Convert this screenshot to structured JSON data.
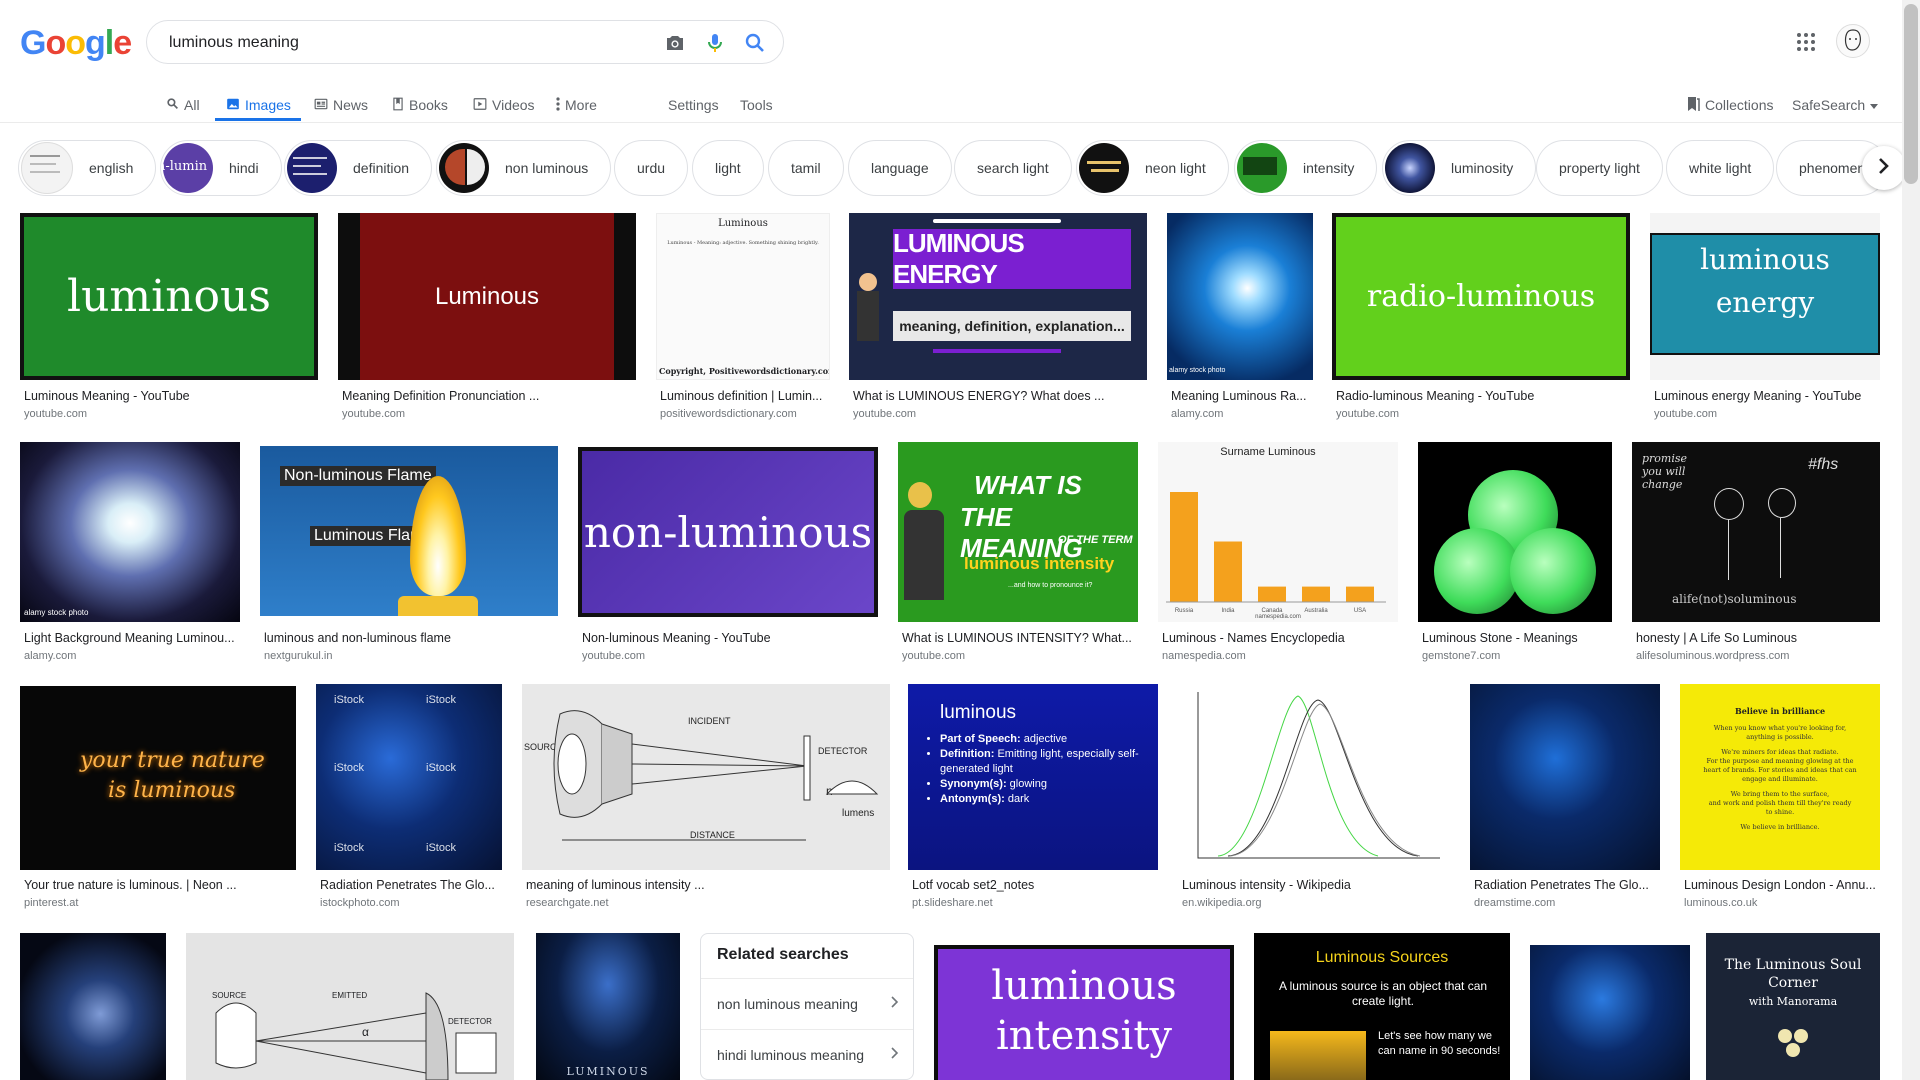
{
  "logo": {
    "letters": [
      "G",
      "o",
      "o",
      "g",
      "l",
      "e"
    ],
    "colors": [
      "#4285f4",
      "#ea4335",
      "#fbbc05",
      "#4285f4",
      "#34a853",
      "#ea4335"
    ]
  },
  "search": {
    "query": "luminous meaning"
  },
  "tabs": [
    {
      "label": "All",
      "icon": "search-icon"
    },
    {
      "label": "Images",
      "icon": "image-icon"
    },
    {
      "label": "News",
      "icon": "news-icon"
    },
    {
      "label": "Books",
      "icon": "book-icon"
    },
    {
      "label": "Videos",
      "icon": "video-icon"
    },
    {
      "label": "More",
      "icon": "more-vert-icon"
    }
  ],
  "settings_label": "Settings",
  "tools_label": "Tools",
  "collections_label": "Collections",
  "safesearch_label": "SafeSearch",
  "chips": [
    {
      "label": "english"
    },
    {
      "label": "hindi"
    },
    {
      "label": "definition"
    },
    {
      "label": "non luminous"
    },
    {
      "label": "urdu"
    },
    {
      "label": "light"
    },
    {
      "label": "tamil"
    },
    {
      "label": "language"
    },
    {
      "label": "search light"
    },
    {
      "label": "neon light"
    },
    {
      "label": "intensity"
    },
    {
      "label": "luminosity"
    },
    {
      "label": "property light"
    },
    {
      "label": "white light"
    },
    {
      "label": "phenomen"
    }
  ],
  "chip_thumb_text": {
    "hindi": "n-lumin"
  },
  "results": [
    {
      "title": "Luminous Meaning - YouTube",
      "source": "youtube.com",
      "img_text": "luminous"
    },
    {
      "title": "Meaning Definition Pronunciation ...",
      "source": "youtube.com",
      "img_text": "Luminous"
    },
    {
      "title": "Luminous definition | Lumin...",
      "source": "positivewordsdictionary.com",
      "img_text": "Luminous",
      "img_subtext": "Luminous - Meaning: adjective. Something shining brightly.",
      "img_footer": "Copyright, Positivewordsdictionary.com"
    },
    {
      "title": "What is LUMINOUS ENERGY? What does ...",
      "source": "youtube.com",
      "img_text": "LUMINOUS ENERGY",
      "img_subtext": "meaning, definition, explanation..."
    },
    {
      "title": "Meaning Luminous Ra...",
      "source": "alamy.com",
      "img_footer": "alamy stock photo"
    },
    {
      "title": "Radio-luminous Meaning - YouTube",
      "source": "youtube.com",
      "img_text": "radio-luminous"
    },
    {
      "title": "Luminous energy Meaning - YouTube",
      "source": "youtube.com",
      "img_text": "luminous",
      "img_subtext": "energy"
    },
    {
      "title": "Light Background Meaning Luminou...",
      "source": "alamy.com",
      "img_footer": "alamy stock photo"
    },
    {
      "title": "luminous and non-luminous flame",
      "source": "nextgurukul.in",
      "img_text": "Non-luminous Flame",
      "img_subtext": "Luminous Flame"
    },
    {
      "title": "Non-luminous Meaning - YouTube",
      "source": "youtube.com",
      "img_text": "non-luminous"
    },
    {
      "title": "What is LUMINOUS INTENSITY? What...",
      "source": "youtube.com",
      "img_text": "WHAT IS",
      "img_subtext": "THE MEANING",
      "img_line3": "OF THE TERM",
      "img_line4": "luminous intensity",
      "img_footer": "...and how to pronounce it?"
    },
    {
      "title": "Luminous - Names Encyclopedia",
      "source": "namespedia.com",
      "img_text": "Surname Luminous",
      "img_footer": "namespedia.com"
    },
    {
      "title": "Luminous Stone - Meanings",
      "source": "gemstone7.com"
    },
    {
      "title": "honesty | A Life So Luminous",
      "source": "alifesoluminous.wordpress.com",
      "img_text": "promise you will change",
      "img_subtext": "#fhs",
      "img_footer": "alife(not)soluminous"
    },
    {
      "title": "Your true nature is luminous. | Neon ...",
      "source": "pinterest.at",
      "img_text": "your true nature",
      "img_subtext": "is luminous"
    },
    {
      "title": "Radiation Penetrates The Glo...",
      "source": "istockphoto.com",
      "img_text": "iStock"
    },
    {
      "title": "meaning of luminous intensity ...",
      "source": "researchgate.net",
      "img_text": "INCIDENT",
      "img_subtext": "SOURCE",
      "img_line3": "DETECTOR",
      "img_line4": "lumens",
      "img_footer": "DISTANCE",
      "img_extra": "n"
    },
    {
      "title": "Lotf vocab set2_notes",
      "source": "pt.slideshare.net",
      "img_text": "luminous",
      "slide_lines": [
        {
          "k": "Part of Speech:",
          "v": " adjective"
        },
        {
          "k": "Definition:",
          "v": " Emitting light, especially self-generated light"
        },
        {
          "k": "Synonym(s):",
          "v": " glowing"
        },
        {
          "k": "Antonym(s):",
          "v": " dark"
        }
      ]
    },
    {
      "title": "Luminous intensity - Wikipedia",
      "source": "en.wikipedia.org"
    },
    {
      "title": "Radiation Penetrates The Glo...",
      "source": "dreamstime.com"
    },
    {
      "title": "Luminous Design London - Annu...",
      "source": "luminous.co.uk",
      "img_text": "Believe in brilliance",
      "img_lines": [
        "When you know what you're looking for,",
        "anything is possible.",
        "We're miners for ideas that radiate.",
        "For the purpose and meaning glowing at the",
        "heart of brands. For stories and ideas that can",
        "engage and illuminate.",
        "We bring them to the surface,",
        "and work and polish them till they're ready",
        "to shine.",
        "We believe in brilliance."
      ]
    }
  ],
  "bottom_row": [
    {
      "img_text": ""
    },
    {
      "img_text": "SOURCE",
      "img_subtext": "EMITTED",
      "img_line3": "DETECTOR",
      "img_line4": "α"
    },
    {
      "img_text": "LUMINOUS"
    },
    {
      "img_text": "luminous",
      "img_subtext": "intensity"
    },
    {
      "img_text": "Luminous Sources",
      "img_subtext": "A luminous source is an object that can create light.",
      "img_line3": "Let's see how many we can name in 90 seconds!"
    },
    {
      "img_text": ""
    },
    {
      "img_text": "The Luminous Soul",
      "img_subtext": "Corner",
      "img_line3": "with Manorama"
    }
  ],
  "related": {
    "heading": "Related searches",
    "items": [
      {
        "label": "non luminous meaning"
      },
      {
        "label": "hindi luminous meaning"
      }
    ]
  },
  "chart_bars": {
    "categories": [
      "Russia",
      "India",
      "Canada",
      "Australia",
      "USA"
    ],
    "values": [
      100,
      55,
      14,
      14,
      14
    ]
  },
  "accent": "#1a73e8"
}
